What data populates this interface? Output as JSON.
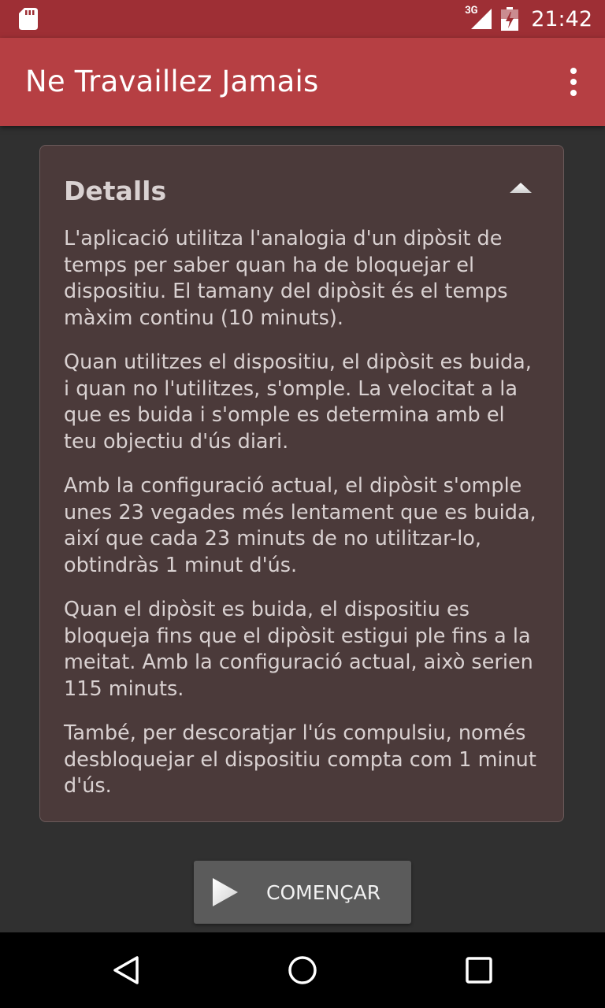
{
  "status_bar": {
    "network": "3G",
    "time": "21:42",
    "icons": [
      "sd-card-icon",
      "signal-icon",
      "battery-icon"
    ]
  },
  "app_bar": {
    "title": "Ne Travaillez Jamais",
    "menu_icon": "overflow-menu-icon"
  },
  "details_card": {
    "title": "Detalls",
    "toggle_icon": "collapse-icon",
    "paragraphs": [
      "L'aplicació utilitza l'analogia d'un dipòsit de temps per saber quan ha de bloquejar el dispositiu. El tamany del dipòsit és el temps màxim continu (10 minuts).",
      "Quan utilitzes el dispositiu, el dipòsit es buida, i quan no l'utilitzes, s'omple. La velocitat a la que es buida i s'omple es determina amb el teu objectiu d'ús diari.",
      "Amb la configuració actual, el dipòsit s'omple unes 23 vegades més lentament que es buida, així que cada 23 minuts de no utilitzar-lo, obtindràs 1 minut d'ús.",
      "Quan el dipòsit es buida, el dispositiu es bloqueja fins que el dipòsit estigui ple fins a la meitat. Amb la configuració actual, això serien 115 minuts.",
      "També, per descoratjar l'ús compulsiu, només desbloquejar el dispositiu compta com 1 minut d'ús."
    ]
  },
  "start_button": {
    "label": "COMENÇAR",
    "icon": "play-icon"
  },
  "nav_bar": {
    "icons": [
      "back-icon",
      "home-icon",
      "recents-icon"
    ]
  }
}
